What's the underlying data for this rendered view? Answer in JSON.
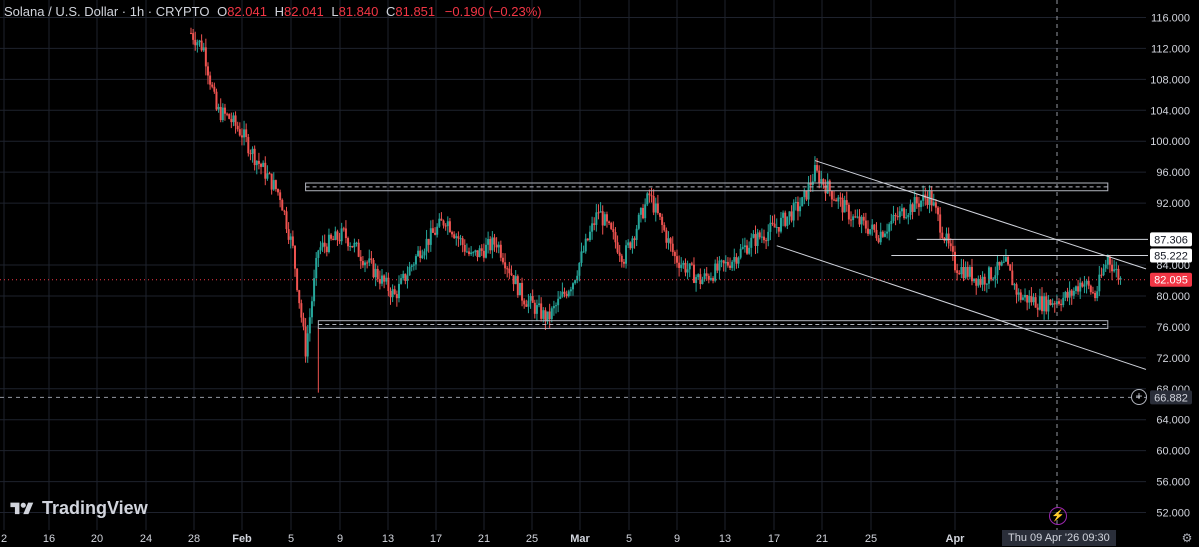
{
  "header": {
    "symbol": "Solana / U.S. Dollar · 1h · CRYPTO",
    "open_label": "O",
    "open_value": "82.041",
    "high_label": "H",
    "high_value": "82.041",
    "low_label": "L",
    "low_value": "81.840",
    "close_label": "C",
    "close_value": "81.851",
    "change": "−0.190 (−0.23%)"
  },
  "branding": {
    "logo_text": "TradingView"
  },
  "colors": {
    "up": "#26a69a",
    "down": "#ef5350",
    "price_tag": "#f23645",
    "background": "#000000",
    "zone": "#b2b5be",
    "grid": "#1e222d"
  },
  "price_axis": {
    "ticks": [
      "116.000",
      "112.000",
      "108.000",
      "104.000",
      "100.000",
      "96.000",
      "92.000",
      "84.000",
      "80.000",
      "76.000",
      "72.000",
      "68.000",
      "64.000",
      "60.000",
      "56.000",
      "52.000"
    ],
    "tick_values": [
      116,
      112,
      108,
      104,
      100,
      96,
      92,
      84,
      80,
      76,
      72,
      68,
      64,
      60,
      56,
      52
    ],
    "level_labels": [
      {
        "text": "87.306",
        "value": 87.306
      },
      {
        "text": "85.222",
        "value": 85.222
      }
    ],
    "current_price": {
      "text": "82.095",
      "value": 82.095
    },
    "crosshair_price": {
      "text": "66.882",
      "value": 66.882
    }
  },
  "time_axis": {
    "labels": [
      "2",
      "16",
      "20",
      "24",
      "28",
      "Feb",
      "5",
      "9",
      "13",
      "17",
      "21",
      "25",
      "Mar",
      "5",
      "9",
      "13",
      "17",
      "21",
      "25",
      "Apr"
    ],
    "crosshair_time": "Thu 09 Apr '26   09:30"
  },
  "icons": {
    "add": "plus-circle-icon",
    "flash": "lightning-icon",
    "settings": "gear-icon"
  },
  "chart_data": {
    "type": "candlestick",
    "title": "Solana / U.S. Dollar · 1h · CRYPTO",
    "ylim": [
      50,
      118
    ],
    "x_start": "2026-01-12",
    "x_end": "2026-04-12",
    "price_path": [
      [
        "2026-01-27",
        114
      ],
      [
        "2026-01-28",
        112
      ],
      [
        "2026-01-29",
        104
      ],
      [
        "2026-01-30",
        103
      ],
      [
        "2026-01-31",
        101
      ],
      [
        "2026-02-01",
        98
      ],
      [
        "2026-02-03",
        93
      ],
      [
        "2026-02-04",
        86
      ],
      [
        "2026-02-05",
        73
      ],
      [
        "2026-02-06",
        86
      ],
      [
        "2026-02-08",
        88
      ],
      [
        "2026-02-10",
        84
      ],
      [
        "2026-02-12",
        80
      ],
      [
        "2026-02-14",
        86
      ],
      [
        "2026-02-16",
        90
      ],
      [
        "2026-02-18",
        85
      ],
      [
        "2026-02-20",
        87
      ],
      [
        "2026-02-22",
        80
      ],
      [
        "2026-02-24",
        77
      ],
      [
        "2026-02-26",
        82
      ],
      [
        "2026-02-28",
        91
      ],
      [
        "2026-03-02",
        85
      ],
      [
        "2026-03-04",
        93
      ],
      [
        "2026-03-06",
        85
      ],
      [
        "2026-03-08",
        82
      ],
      [
        "2026-03-10",
        84
      ],
      [
        "2026-03-12",
        87
      ],
      [
        "2026-03-14",
        89
      ],
      [
        "2026-03-16",
        92
      ],
      [
        "2026-03-17",
        96
      ],
      [
        "2026-03-18",
        94
      ],
      [
        "2026-03-20",
        90
      ],
      [
        "2026-03-22",
        88
      ],
      [
        "2026-03-24",
        91
      ],
      [
        "2026-03-26",
        93
      ],
      [
        "2026-03-28",
        84
      ],
      [
        "2026-03-30",
        82
      ],
      [
        "2026-04-01",
        84
      ],
      [
        "2026-04-02",
        80
      ],
      [
        "2026-04-04",
        79
      ],
      [
        "2026-04-06",
        80
      ],
      [
        "2026-04-07",
        82
      ],
      [
        "2026-04-08",
        80
      ],
      [
        "2026-04-09",
        85
      ],
      [
        "2026-04-10",
        82.1
      ]
    ],
    "drawings": {
      "resistance_zone": {
        "from": "2026-02-05",
        "to": "2026-04-09",
        "top": 94.6,
        "bottom": 93.6
      },
      "support_zone": {
        "from": "2026-02-06",
        "to": "2026-04-09",
        "top": 76.8,
        "bottom": 75.8
      },
      "channel_upper": {
        "from": [
          "2026-03-17",
          97.5
        ],
        "to": [
          "2026-04-12",
          83.5
        ]
      },
      "channel_lower": {
        "from": [
          "2026-03-14",
          86.5
        ],
        "to": [
          "2026-04-12",
          70.5
        ]
      },
      "level_lines": [
        {
          "from": "2026-03-25",
          "value": 87.306
        },
        {
          "from": "2026-03-23",
          "value": 85.222
        }
      ]
    }
  }
}
